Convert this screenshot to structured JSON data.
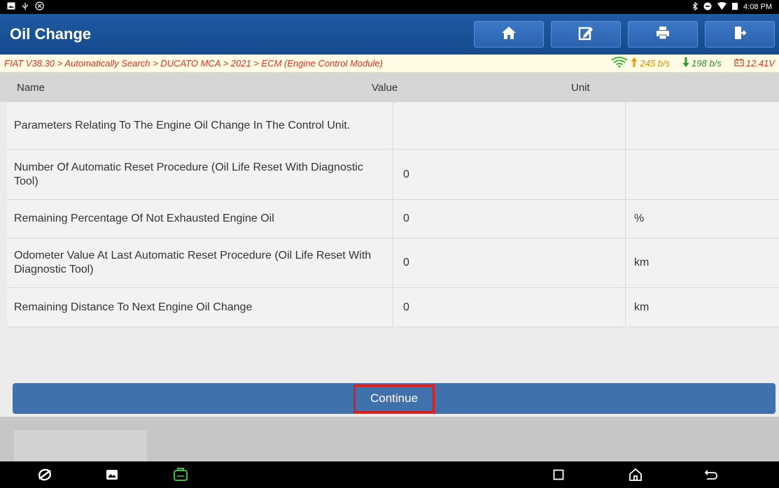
{
  "status_bar": {
    "time": "4:08 PM"
  },
  "app": {
    "title": "Oil Change"
  },
  "toolbar": {
    "buttons": [
      {
        "icon": "home-icon"
      },
      {
        "icon": "edit-icon"
      },
      {
        "icon": "print-icon"
      },
      {
        "icon": "exit-icon"
      }
    ]
  },
  "breadcrumb": {
    "path": "FIAT V38.30 > Automatically Search > DUCATO MCA > 2021 > ECM (Engine Control Module)",
    "upload": "245 b/s",
    "download": "198 b/s",
    "voltage": "12.41V"
  },
  "table": {
    "headers": {
      "name": "Name",
      "value": "Value",
      "unit": "Unit"
    },
    "rows": [
      {
        "name": "Parameters Relating To The Engine Oil Change In The Control Unit.",
        "value": "",
        "unit": ""
      },
      {
        "name": "Number Of Automatic Reset Procedure (Oil Life Reset With Diagnostic Tool)",
        "value": "0",
        "unit": ""
      },
      {
        "name": "Remaining Percentage Of Not Exhausted Engine Oil",
        "value": "0",
        "unit": "%"
      },
      {
        "name": "Odometer Value At Last Automatic Reset Procedure (Oil Life Reset With Diagnostic Tool)",
        "value": "0",
        "unit": "km"
      },
      {
        "name": "Remaining Distance To Next Engine Oil Change",
        "value": "0",
        "unit": "km"
      }
    ]
  },
  "actions": {
    "continue_label": "Continue"
  },
  "colors": {
    "header_blue": "#1f5aa3",
    "continue_blue": "#3f71ac",
    "highlight_red": "#e01d1d",
    "crumb_red": "#e2341d"
  }
}
